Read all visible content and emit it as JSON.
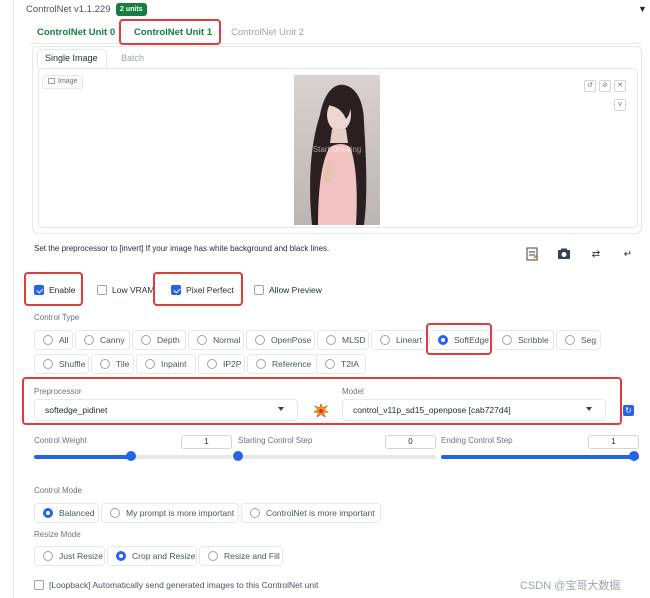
{
  "header": {
    "title": "ControlNet v1.1.229",
    "units_badge": "2 units",
    "collapse_icon": "triangle-down-icon"
  },
  "unit_tabs": [
    {
      "label": "ControlNet Unit 0",
      "active": false
    },
    {
      "label": "ControlNet Unit 1",
      "active": true
    },
    {
      "label": "ControlNet Unit 2",
      "active": false
    }
  ],
  "image_tabs": [
    {
      "label": "Single Image",
      "active": true
    },
    {
      "label": "Batch",
      "active": false
    }
  ],
  "image_panel": {
    "image_label": "Image",
    "placeholder": "Start Drawing",
    "buttons": {
      "undo": "↺",
      "clear": "⊘",
      "close": "✕",
      "brush": "ν"
    }
  },
  "hint_text": "Set the preprocessor to [invert] If your image has white background and black lines.",
  "tool_icons": [
    "notepad-icon",
    "camera-icon",
    "swap-icon",
    "send-icon"
  ],
  "options": {
    "enable": {
      "label": "Enable",
      "checked": true
    },
    "low_vram": {
      "label": "Low VRAM",
      "checked": false
    },
    "pixel_perfect": {
      "label": "Pixel Perfect",
      "checked": true
    },
    "allow_preview": {
      "label": "Allow Preview",
      "checked": false
    }
  },
  "control_type": {
    "label": "Control Type",
    "selected": "SoftEdge",
    "row1": [
      "All",
      "Canny",
      "Depth",
      "Normal",
      "OpenPose",
      "MLSD",
      "Lineart",
      "SoftEdge",
      "Scribble",
      "Seg"
    ],
    "row2": [
      "Shuffle",
      "Tile",
      "Inpaint",
      "IP2P",
      "Reference",
      "T2IA"
    ]
  },
  "preprocessor": {
    "label": "Preprocessor",
    "value": "softedge_pidinet",
    "run_icon": "explosion-icon"
  },
  "model": {
    "label": "Model",
    "value": "control_v11p_sd15_openpose [cab727d4]",
    "refresh_icon": "refresh-icon"
  },
  "control_weight": {
    "label": "Control Weight",
    "value": "1",
    "fraction": 0.49
  },
  "start_step": {
    "label": "Starting Control Step",
    "value": "0",
    "fraction": 0.0
  },
  "end_step": {
    "label": "Ending Control Step",
    "value": "1",
    "fraction": 1.0
  },
  "control_mode": {
    "label": "Control Mode",
    "selected": "Balanced",
    "options": [
      "Balanced",
      "My prompt is more important",
      "ControlNet is more important"
    ]
  },
  "resize_mode": {
    "label": "Resize Mode",
    "selected": "Crop and Resize",
    "options": [
      "Just Resize",
      "Crop and Resize",
      "Resize and Fill"
    ]
  },
  "loopback": {
    "label": "[Loopback] Automatically send generated images to this ControlNet unit",
    "checked": false
  },
  "watermark": "CSDN @宝哥大数据",
  "colors": {
    "accent": "#2563eb",
    "brand_green": "#15803d",
    "highlight_red": "#e03c3c"
  }
}
